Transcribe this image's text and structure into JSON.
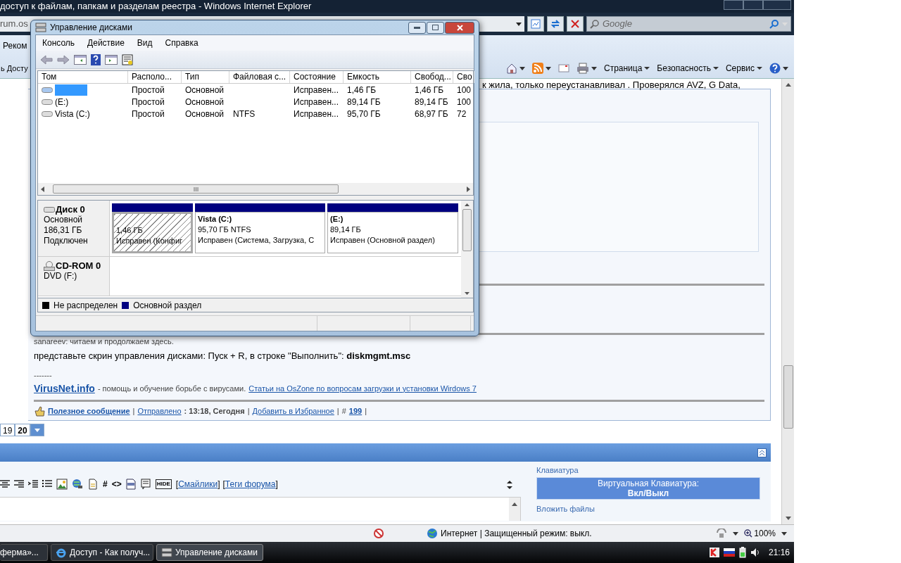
{
  "browser": {
    "title": "доступ к файлам, папкам и разделам реестра - Windows Internet Explorer",
    "address": "rum.os",
    "search_placeholder": "Google",
    "favorites_item": "Реком",
    "tab": "ь Досту",
    "commands": [
      "Страница",
      "Безопасность",
      "Сервис"
    ]
  },
  "dialog": {
    "title": "Управление дисками",
    "menu": [
      "Консоль",
      "Действие",
      "Вид",
      "Справка"
    ],
    "columns": [
      "Том",
      "Располо...",
      "Тип",
      "Файловая с...",
      "Состояние",
      "Емкость",
      "Свобод...",
      "Сво"
    ],
    "volumes": [
      {
        "selected": true,
        "cells": [
          "Простой",
          "Основной",
          "",
          "Исправен...",
          "1,46 ГБ",
          "1,46 ГБ",
          "100"
        ]
      },
      {
        "selected": false,
        "name": "(E:)",
        "cells": [
          "Простой",
          "Основной",
          "",
          "Исправен...",
          "89,14 ГБ",
          "89,14 ГБ",
          "100"
        ]
      },
      {
        "selected": false,
        "name": "Vista (C:)",
        "cells": [
          "Простой",
          "Основной",
          "NTFS",
          "Исправен...",
          "95,70 ГБ",
          "68,97 ГБ",
          "72"
        ]
      }
    ],
    "disks": [
      {
        "kind": "hdd",
        "name": "Диск 0",
        "lines": [
          "Основной",
          "186,31 ГБ",
          "Подключен"
        ],
        "partitions": [
          {
            "selected": true,
            "lines": [
              "1,46 ГБ",
              "Исправен (Конфиг"
            ]
          },
          {
            "selected": false,
            "title": "Vista  (C:)",
            "lines": [
              "95,70 ГБ NTFS",
              "Исправен (Система, Загрузка, С"
            ]
          },
          {
            "selected": false,
            "title": "(E:)",
            "lines": [
              "89,14 ГБ",
              "Исправен (Основной раздел)"
            ]
          }
        ]
      },
      {
        "kind": "cdrom",
        "name": "CD-ROM 0",
        "lines": [
          "DVD (F:)"
        ]
      }
    ],
    "legend": [
      {
        "label": "Не распределен",
        "color": "#000000"
      },
      {
        "label": "Основной раздел",
        "color": "#000080"
      }
    ]
  },
  "forum": {
    "hidden_line": "к жила, только переустанавливал . Проверялся AVZ, G Data,",
    "quote_line": "sanareev: читаем и продолжаем здесь.",
    "message": "представьте скрин управления дисками: Пуск + R, в строке \"Выполнить\": **diskmgmt.msc**",
    "signature_separator": "-------",
    "signature_link": "VirusNet.info",
    "signature_text": "- помощь и обучение борьбе с вирусами.",
    "signature_link2": "Статьи на OsZone по вопросам загрузки и установки Wirdows 7",
    "footer": {
      "helpful": "Полезное сообщение",
      "separator": "|",
      "sent_label": "Отправлено",
      "sent_time": ": 13:18, Сегодня",
      "favorite": "Добавить в Избранное",
      "hash": "#",
      "post_number": "199"
    }
  },
  "pages": [
    {
      "label": "19",
      "selected": false
    },
    {
      "label": "20",
      "selected": true
    }
  ],
  "editor": {
    "glyphs": [
      "#",
      "<>"
    ],
    "hide_label": "HIDE",
    "open_bracket": "[",
    "close_bracket": "]",
    "smilies": "Смайлики",
    "tags": "Теги форума"
  },
  "sidebar": {
    "keyboard_title": "Клавиатура",
    "keyboard_button": [
      "Виртуальная Клавиатура:",
      "Вкл/Выкл"
    ],
    "attach_title": "Вложить файлы"
  },
  "status": {
    "zone": "Интернет | Защищенный режим: выкл.",
    "zoom": "100%"
  },
  "taskbar": {
    "buttons": [
      {
        "label": "ферма»...",
        "selected": false
      },
      {
        "label": "Доступ - Как получ...",
        "selected": false
      },
      {
        "label": "Управление дисками",
        "selected": true
      }
    ],
    "clock": "21:16"
  }
}
